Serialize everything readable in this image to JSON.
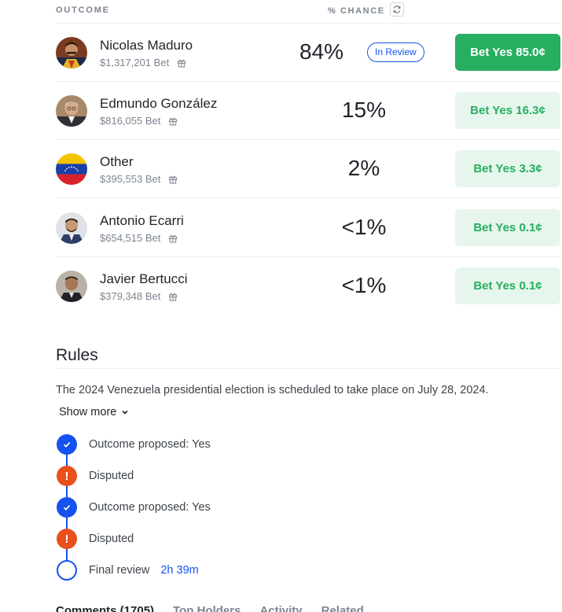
{
  "header": {
    "outcome_label": "OUTCOME",
    "chance_label": "% CHANCE"
  },
  "outcomes": [
    {
      "name": "Nicolas Maduro",
      "volume": "$1,317,201 Bet",
      "chance": "84%",
      "badge": "In Review",
      "bet_label": "Bet Yes 85.0¢"
    },
    {
      "name": "Edmundo González",
      "volume": "$816,055 Bet",
      "chance": "15%",
      "bet_label": "Bet Yes 16.3¢"
    },
    {
      "name": "Other",
      "volume": "$395,553 Bet",
      "chance": "2%",
      "bet_label": "Bet Yes 3.3¢"
    },
    {
      "name": "Antonio Ecarri",
      "volume": "$654,515 Bet",
      "chance": "<1%",
      "bet_label": "Bet Yes 0.1¢"
    },
    {
      "name": "Javier Bertucci",
      "volume": "$379,348 Bet",
      "chance": "<1%",
      "bet_label": "Bet Yes 0.1¢"
    }
  ],
  "rules": {
    "title": "Rules",
    "text": "The 2024 Venezuela presidential election is scheduled to take place on July 28, 2024.",
    "show_more": "Show more"
  },
  "timeline": [
    {
      "label": "Outcome proposed: Yes",
      "status": "check"
    },
    {
      "label": "Disputed",
      "status": "warn",
      "icon_text": "!"
    },
    {
      "label": "Outcome proposed: Yes",
      "status": "check"
    },
    {
      "label": "Disputed",
      "status": "warn",
      "icon_text": "!"
    },
    {
      "label": "Final review",
      "status": "pending",
      "time": "2h 39m"
    }
  ],
  "tabs": [
    "Comments (1705)",
    "Top Holders",
    "Activity",
    "Related"
  ],
  "colors": {
    "green": "#27ae60",
    "green_soft": "#e7f6ec",
    "blue": "#1652f0",
    "orange": "#e8501c"
  }
}
